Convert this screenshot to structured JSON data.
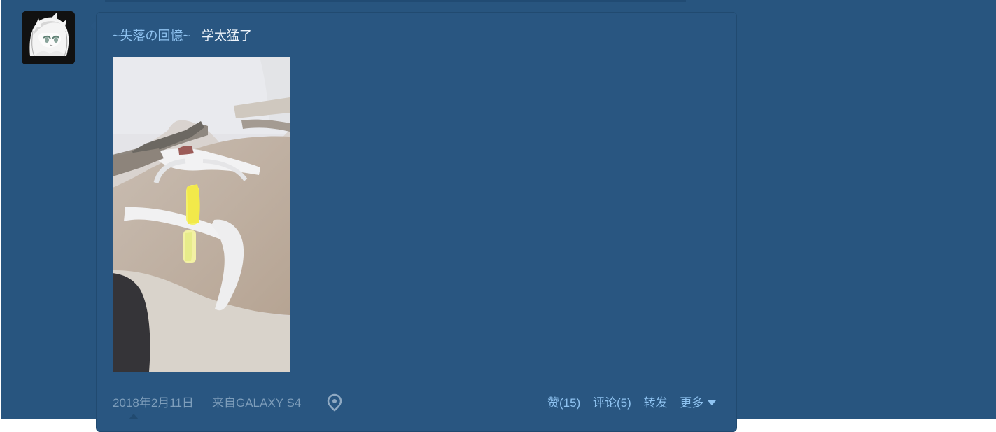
{
  "post": {
    "author": "~失落の回憶~",
    "text": "学太猛了",
    "date": "2018年2月11日",
    "source": "来自GALAXY S4"
  },
  "actions": {
    "like": "赞(15)",
    "comment": "评论(5)",
    "repost": "转发",
    "more": "更多"
  },
  "icons": {
    "location": "location-pin-icon",
    "more": "chevron-down-icon"
  },
  "colors": {
    "background": "#28557f",
    "card": "#295681",
    "link": "#8fc3f1",
    "text": "#eef4fb",
    "meta": "#7e9ebb"
  }
}
